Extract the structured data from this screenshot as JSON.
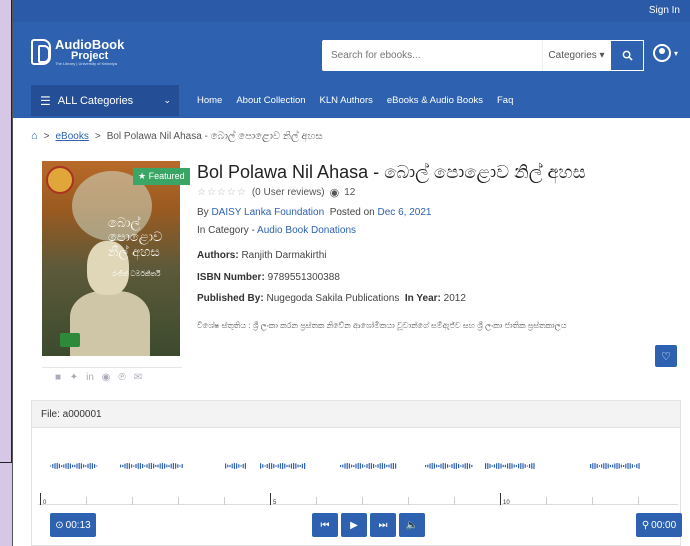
{
  "topbar": {
    "signin": "Sign In"
  },
  "logo": {
    "line1": "AudioBook",
    "line2": "Project",
    "line3": "The Library | University of Kelaniya"
  },
  "search": {
    "placeholder": "Search for ebooks...",
    "category": "Categories ▾",
    "button_icon": "search-icon"
  },
  "user": {
    "icon": "user-icon",
    "caret": "▾"
  },
  "nav": {
    "all_categories": "ALL Categories",
    "links": [
      "Home",
      "About Collection",
      "KLN Authors",
      "eBooks & Audio Books",
      "Faq"
    ]
  },
  "breadcrumb": {
    "home_icon": "home-icon",
    "sep": ">",
    "ebooks": "eBooks",
    "current": "Bol Polawa Nil Ahasa - බොල් පොළොව නිල් අහස"
  },
  "cover": {
    "featured": "★ Featured",
    "title_si": "බොල් පොළොව නිල් අහස",
    "author_si": "රංජිත් ධර්මකීර්ති"
  },
  "book": {
    "title": "Bol Polawa Nil Ahasa - බොල් පොළොව නිල් අහස",
    "stars": "☆☆☆☆☆",
    "reviews": "(0 User reviews)",
    "views_icon": "eye-icon",
    "views": "12",
    "by_label": "By",
    "publisher_link": "DAISY Lanka Foundation",
    "posted_label": "Posted on",
    "posted_date": "Dec 6, 2021",
    "category_label": "In Category -",
    "category": "Audio Book Donations",
    "authors_label": "Authors:",
    "authors": "Ranjith Darmakirthi",
    "isbn_label": "ISBN Number:",
    "isbn": "9789551300388",
    "published_label": "Published By:",
    "published_by": "Nugegoda Sakila Publications",
    "year_label": "In Year:",
    "year": "2012",
    "description": "විශේෂ ස්තුතිය : ශ්‍රී ලංකා කරන ප්‍රස්තක නිවේන ආශෝමිකයා වූවාන්ගේ සම්ඇජ්ව සහ ශ්‍රී ලංකා ජාතික ප්‍රස්තකාලය"
  },
  "share": {
    "icons": [
      "facebook-icon",
      "twitter-icon",
      "linkedin-icon",
      "reddit-icon",
      "pinterest-icon",
      "email-icon"
    ]
  },
  "player": {
    "file_label": "File: a000001",
    "tick_labels": [
      "0",
      "5",
      "10"
    ],
    "current_time": "00:13",
    "end_time": "00:00",
    "colors": {
      "waveform": "#2e62b0",
      "button": "#2e62b0"
    }
  }
}
